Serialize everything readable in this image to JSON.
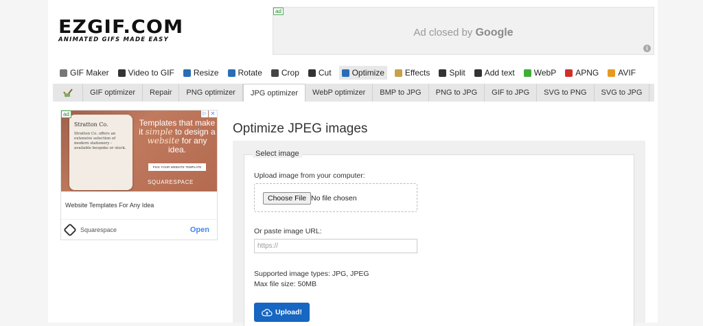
{
  "logo": {
    "main": "EZGIF.COM",
    "tagline": "ANIMATED GIFS MADE EASY"
  },
  "top_ad": {
    "tag": "ad",
    "closed_prefix": "Ad closed by ",
    "closed_brand": "Google"
  },
  "main_nav": [
    {
      "label": "GIF Maker",
      "icon": "gif-maker-icon",
      "color": "#777"
    },
    {
      "label": "Video to GIF",
      "icon": "film-icon",
      "color": "#333"
    },
    {
      "label": "Resize",
      "icon": "resize-icon",
      "color": "#2a6db5"
    },
    {
      "label": "Rotate",
      "icon": "rotate-icon",
      "color": "#2a6db5"
    },
    {
      "label": "Crop",
      "icon": "crop-icon",
      "color": "#444"
    },
    {
      "label": "Cut",
      "icon": "cut-icon",
      "color": "#333"
    },
    {
      "label": "Optimize",
      "icon": "optimize-icon",
      "color": "#2a6db5"
    },
    {
      "label": "Effects",
      "icon": "effects-icon",
      "color": "#c8a04a"
    },
    {
      "label": "Split",
      "icon": "split-icon",
      "color": "#333"
    },
    {
      "label": "Add text",
      "icon": "add-text-icon",
      "color": "#333"
    },
    {
      "label": "WebP",
      "icon": "webp-icon",
      "color": "#3fae35"
    },
    {
      "label": "APNG",
      "icon": "apng-icon",
      "color": "#d0302a"
    },
    {
      "label": "AVIF",
      "icon": "avif-icon",
      "color": "#e69a20"
    }
  ],
  "sub_nav": [
    "GIF optimizer",
    "Repair",
    "PNG optimizer",
    "JPG optimizer",
    "WebP optimizer",
    "BMP to JPG",
    "PNG to JPG",
    "GIF to JPG",
    "SVG to PNG",
    "SVG to JPG"
  ],
  "side_ad": {
    "tag": "ad",
    "card_title": "Stratton Co.",
    "card_body": "Stratton Co. offers an extensive selection of modern stationery - available bespoke or stock.",
    "headline_1": "Templates that make it ",
    "headline_em1": "simple",
    "headline_2": " to design a ",
    "headline_em2": "website",
    "headline_3": " for any idea.",
    "cta": "PICK YOUR WEBSITE TEMPLATE",
    "brand": "SQUARESPACE",
    "caption": "Website Templates For Any Idea",
    "advertiser": "Squarespace",
    "open": "Open"
  },
  "main": {
    "title": "Optimize JPEG images",
    "legend": "Select image",
    "upload_label": "Upload image from your computer:",
    "choose_button": "Choose File",
    "no_file": "No file chosen",
    "url_label": "Or paste image URL:",
    "url_placeholder": "https://",
    "supported": "Supported image types: JPG, JPEG",
    "max_size": "Max file size: 50MB",
    "upload_button": "Upload!"
  }
}
